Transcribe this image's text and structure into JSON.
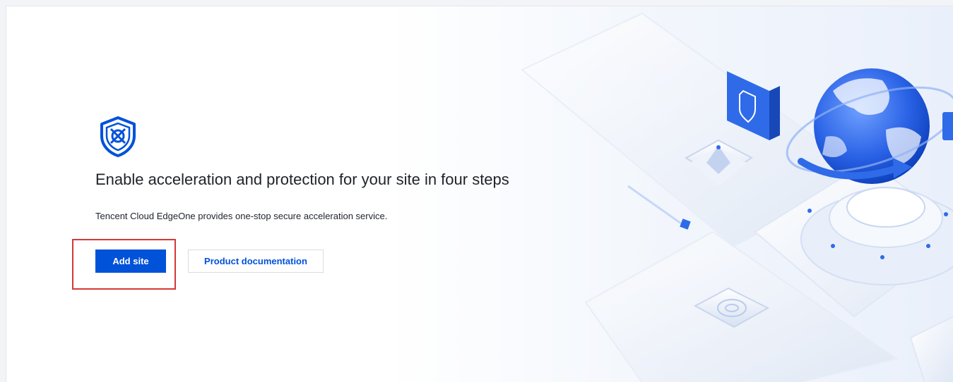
{
  "hero": {
    "title": "Enable acceleration and protection for your site in four steps",
    "subtitle": "Tencent Cloud EdgeOne provides one-stop secure acceleration service.",
    "logo_icon": "edgeone-shield-icon",
    "illustration": "globe-network-illustration"
  },
  "actions": {
    "add_site_label": "Add site",
    "docs_label": "Product documentation"
  },
  "colors": {
    "primary": "#0052d9",
    "highlight": "#d43838",
    "text": "#1f2329"
  }
}
